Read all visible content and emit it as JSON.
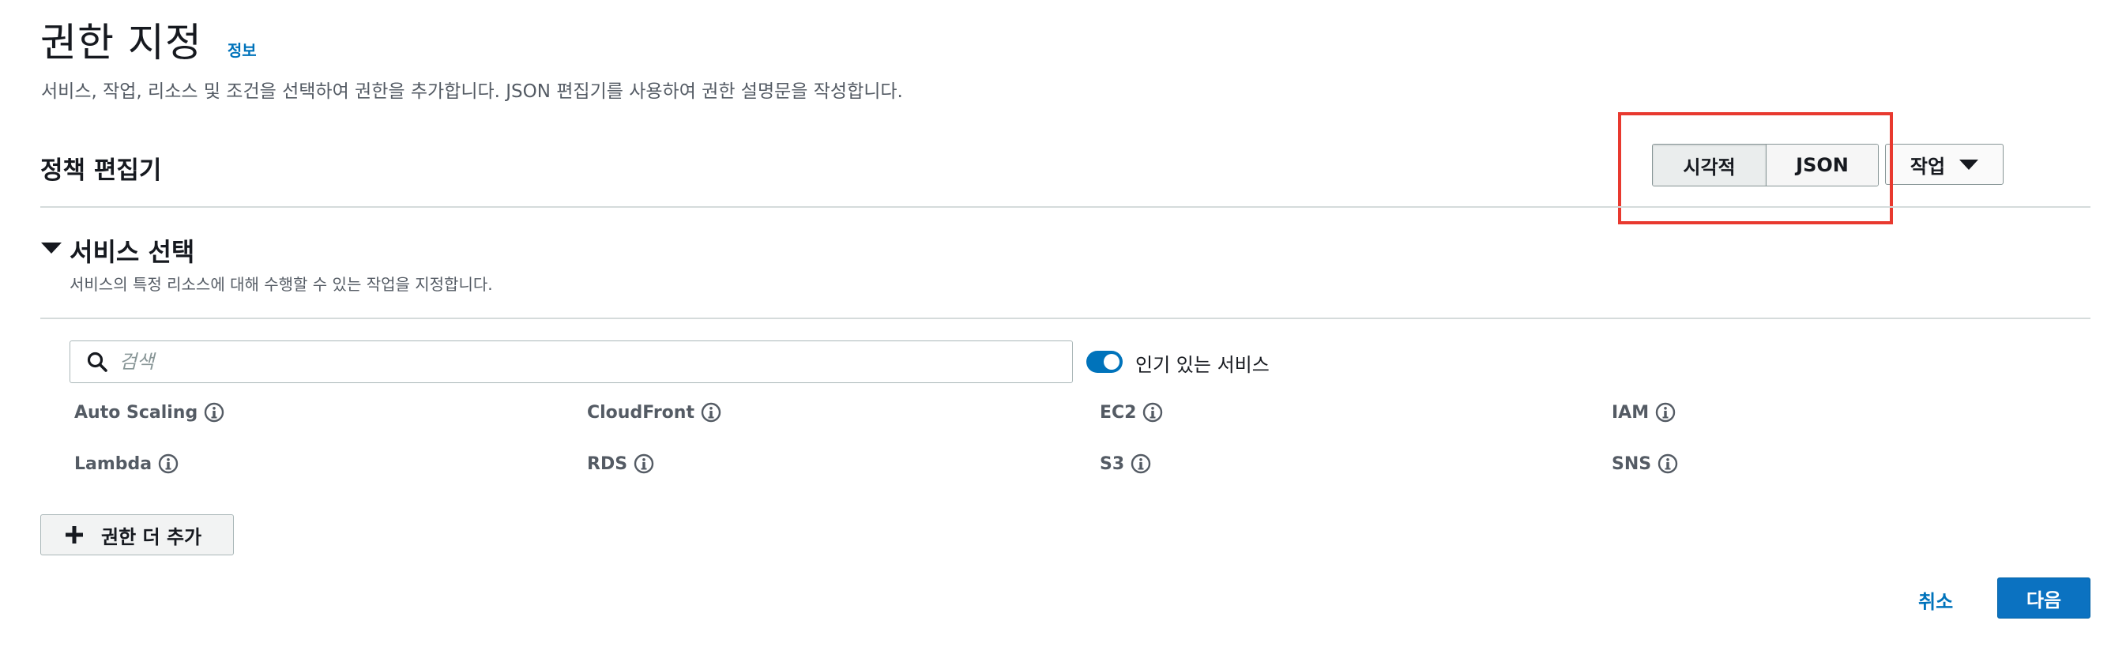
{
  "header": {
    "title": "권한 지정",
    "info_link": "정보",
    "description": "서비스, 작업, 리소스 및 조건을 선택하여 권한을 추가합니다. JSON 편집기를 사용하여 권한 설명문을 작성합니다."
  },
  "policy_editor": {
    "title": "정책 편집기",
    "mode_tabs": [
      {
        "label": "시각적",
        "selected": true
      },
      {
        "label": "JSON",
        "selected": false
      }
    ],
    "actions_label": "작업"
  },
  "service_section": {
    "title": "서비스 선택",
    "description": "서비스의 특정 리소스에 대해 수행할 수 있는 작업을 지정합니다.",
    "search_placeholder": "검색",
    "popular_toggle_label": "인기 있는 서비스",
    "popular_toggle_on": true,
    "services": [
      {
        "name": "Auto Scaling"
      },
      {
        "name": "CloudFront"
      },
      {
        "name": "EC2"
      },
      {
        "name": "IAM"
      },
      {
        "name": "Lambda"
      },
      {
        "name": "RDS"
      },
      {
        "name": "S3"
      },
      {
        "name": "SNS"
      }
    ]
  },
  "footer": {
    "add_permissions_label": "권한 더 추가",
    "cancel_label": "취소",
    "next_label": "다음"
  },
  "colors": {
    "link_blue": "#0073bb",
    "primary_button": "#0b72c1",
    "highlight_red": "#e8392f",
    "text_dark": "#16191f",
    "text_muted": "#545b64"
  }
}
